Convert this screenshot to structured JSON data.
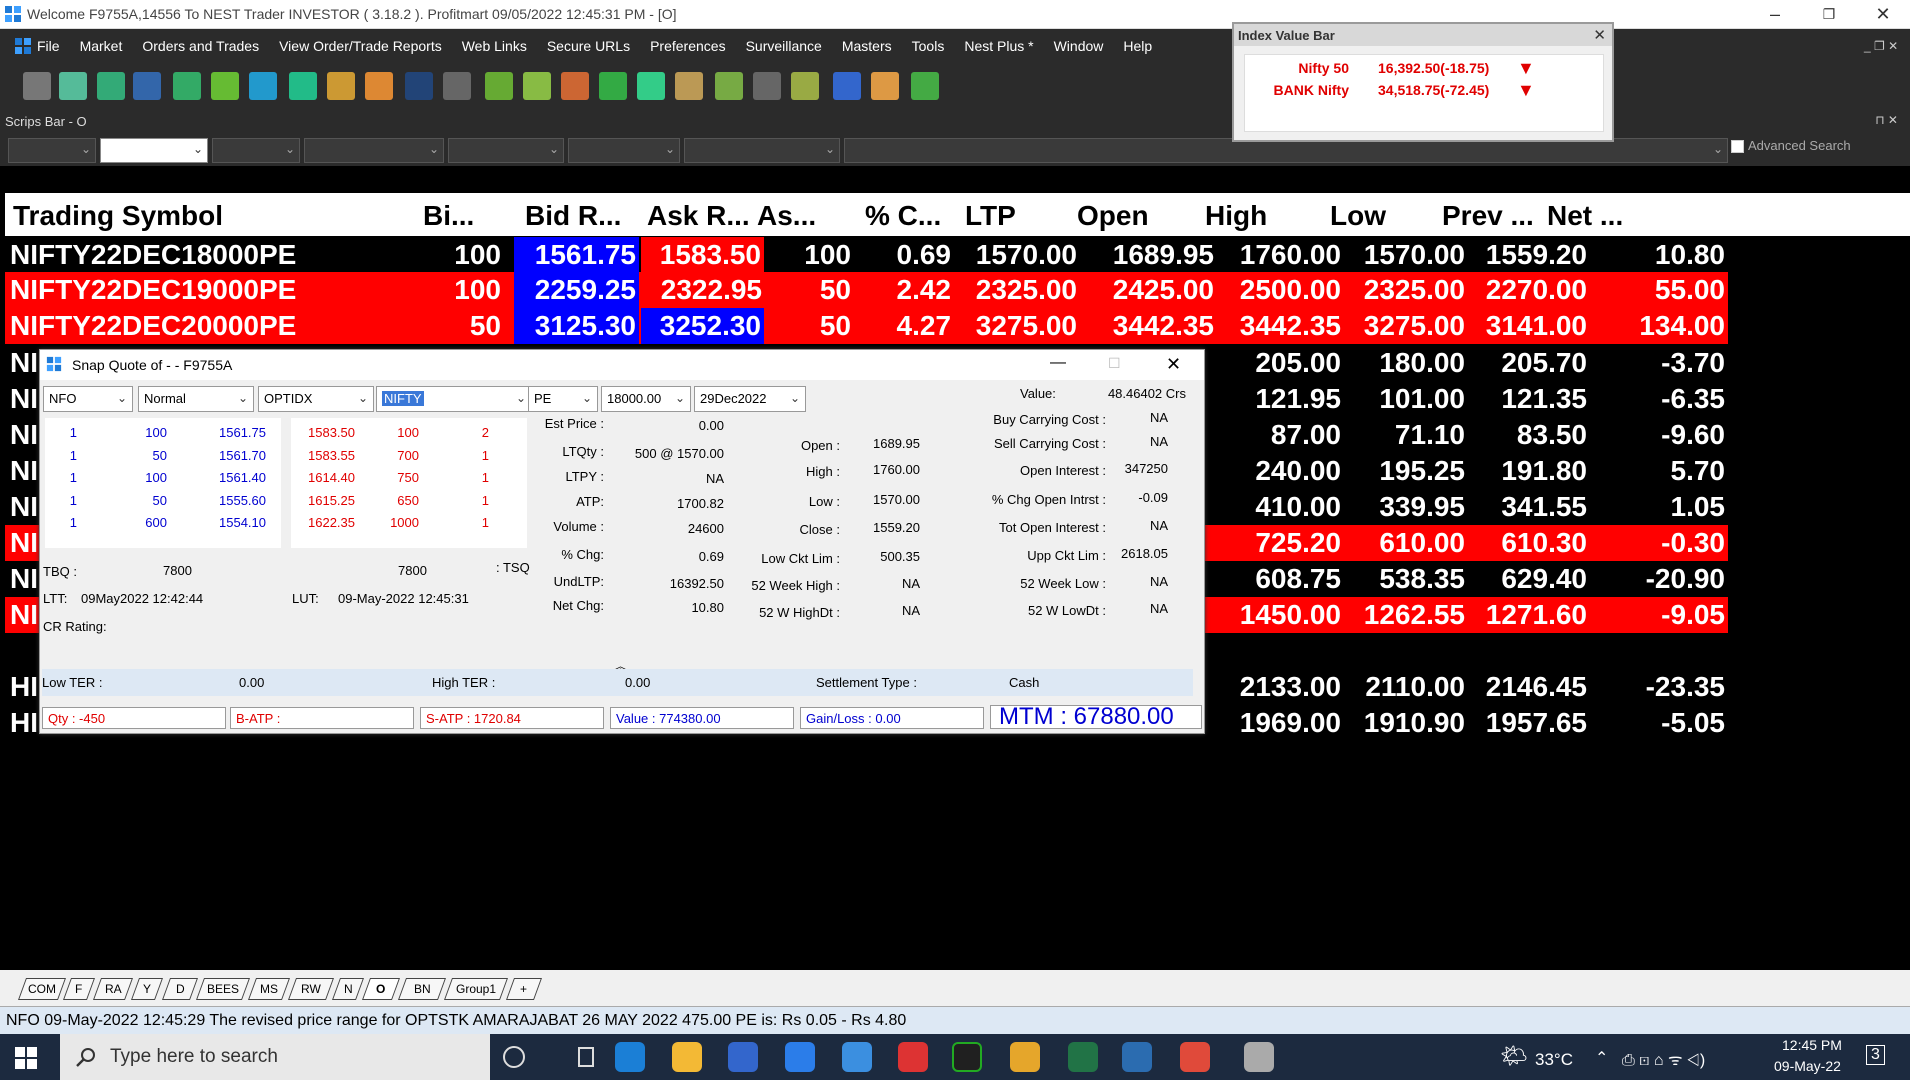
{
  "window": {
    "title": "Welcome F9755A,14556 To NEST Trader INVESTOR ( 3.18.2 ).  Profitmart  09/05/2022  12:45:31 PM - [O]"
  },
  "menu": [
    "File",
    "Market",
    "Orders and Trades",
    "View Order/Trade Reports",
    "Web Links",
    "Secure URLs",
    "Preferences",
    "Surveillance",
    "Masters",
    "Tools",
    "Nest Plus *",
    "Window",
    "Help"
  ],
  "scrips_bar": {
    "label": "Scrips Bar - O",
    "advanced_search": "Advanced Search"
  },
  "index_value_bar": {
    "title": "Index Value Bar",
    "rows": [
      {
        "name": "Nifty 50",
        "value": "16,392.50(-18.75)"
      },
      {
        "name": "BANK Nifty",
        "value": "34,518.75(-72.45)"
      }
    ]
  },
  "market_watch": {
    "headers": [
      "Trading Symbol",
      "Bi...",
      "Bid R...",
      "Ask R...",
      "As...",
      "% C...",
      "LTP",
      "Open",
      "High",
      "Low",
      "Prev ...",
      "Net ..."
    ],
    "rows": [
      {
        "sym": "NIFTY22DEC18000PE",
        "bq": "100",
        "bid": "1561.75",
        "ask": "1583.50",
        "aq": "100",
        "chg": "0.69",
        "ltp": "1570.00",
        "open": "1689.95",
        "high": "1760.00",
        "low": "1570.00",
        "prev": "1559.20",
        "net": "10.80"
      },
      {
        "sym": "NIFTY22DEC19000PE",
        "bq": "100",
        "bid": "2259.25",
        "ask": "2322.95",
        "aq": "50",
        "chg": "2.42",
        "ltp": "2325.00",
        "open": "2425.00",
        "high": "2500.00",
        "low": "2325.00",
        "prev": "2270.00",
        "net": "55.00"
      },
      {
        "sym": "NIFTY22DEC20000PE",
        "bq": "50",
        "bid": "3125.30",
        "ask": "3252.30",
        "aq": "50",
        "chg": "4.27",
        "ltp": "3275.00",
        "open": "3442.35",
        "high": "3442.35",
        "low": "3275.00",
        "prev": "3141.00",
        "net": "134.00"
      },
      {
        "sym": "NI",
        "high": "205.00",
        "low": "180.00",
        "prev": "205.70",
        "net": "-3.70"
      },
      {
        "sym": "NI",
        "high": "121.95",
        "low": "101.00",
        "prev": "121.35",
        "net": "-6.35"
      },
      {
        "sym": "NI",
        "high": "87.00",
        "low": "71.10",
        "prev": "83.50",
        "net": "-9.60"
      },
      {
        "sym": "NI",
        "high": "240.00",
        "low": "195.25",
        "prev": "191.80",
        "net": "5.70"
      },
      {
        "sym": "NI",
        "high": "410.00",
        "low": "339.95",
        "prev": "341.55",
        "net": "1.05"
      },
      {
        "sym": "NI",
        "high": "725.20",
        "low": "610.00",
        "prev": "610.30",
        "net": "-0.30"
      },
      {
        "sym": "NI",
        "high": "608.75",
        "low": "538.35",
        "prev": "629.40",
        "net": "-20.90"
      },
      {
        "sym": "NI",
        "high": "1450.00",
        "low": "1262.55",
        "prev": "1271.60",
        "net": "-9.05"
      },
      {
        "sym": "HI",
        "high": "2133.00",
        "low": "2110.00",
        "prev": "2146.45",
        "net": "-23.35"
      },
      {
        "sym": "HI",
        "high": "1969.00",
        "low": "1910.90",
        "prev": "1957.65",
        "net": "-5.05"
      }
    ]
  },
  "snap_quote": {
    "title": "Snap Quote of  -  - F9755A",
    "filters": [
      "NFO",
      "Normal",
      "OPTIDX",
      "NIFTY",
      "PE",
      "18000.00",
      "29Dec2022"
    ],
    "value_label": "Value:",
    "value": "48.46402 Crs",
    "bids": [
      {
        "o": "1",
        "q": "100",
        "p": "1561.75"
      },
      {
        "o": "1",
        "q": "50",
        "p": "1561.70"
      },
      {
        "o": "1",
        "q": "100",
        "p": "1561.40"
      },
      {
        "o": "1",
        "q": "50",
        "p": "1555.60"
      },
      {
        "o": "1",
        "q": "600",
        "p": "1554.10"
      }
    ],
    "asks": [
      {
        "p": "1583.50",
        "q": "100",
        "o": "2"
      },
      {
        "p": "1583.55",
        "q": "700",
        "o": "1"
      },
      {
        "p": "1614.40",
        "q": "750",
        "o": "1"
      },
      {
        "p": "1615.25",
        "q": "650",
        "o": "1"
      },
      {
        "p": "1622.35",
        "q": "1000",
        "o": "1"
      }
    ],
    "tbq_label": "TBQ :",
    "tbq": "7800",
    "tsq": "7800",
    "tsq_label": ": TSQ",
    "ltt_label": "LTT:",
    "ltt": "09May2022 12:42:44",
    "lut_label": "LUT:",
    "lut": "09-May-2022 12:45:31",
    "cr_rating": "CR Rating:",
    "col1": [
      {
        "l": "Est Price :",
        "v": "0.00"
      },
      {
        "l": "LTQty :",
        "v": "500 @  1570.00"
      },
      {
        "l": "LTPY :",
        "v": "NA"
      },
      {
        "l": "ATP:",
        "v": "1700.82"
      },
      {
        "l": "Volume :",
        "v": "24600"
      },
      {
        "l": "% Chg:",
        "v": "0.69"
      },
      {
        "l": "UndLTP:",
        "v": "16392.50"
      },
      {
        "l": "Net Chg:",
        "v": "10.80"
      }
    ],
    "col2": [
      {
        "l": "Open :",
        "v": "1689.95"
      },
      {
        "l": "High :",
        "v": "1760.00"
      },
      {
        "l": "Low :",
        "v": "1570.00"
      },
      {
        "l": "Close :",
        "v": "1559.20"
      },
      {
        "l": "Low Ckt Lim :",
        "v": "500.35"
      },
      {
        "l": "52 Week High :",
        "v": "NA"
      },
      {
        "l": "52 W HighDt :",
        "v": "NA"
      }
    ],
    "col3": [
      {
        "l": "Buy Carrying Cost :",
        "v": "NA"
      },
      {
        "l": "Sell Carrying Cost :",
        "v": "NA"
      },
      {
        "l": "Open Interest :",
        "v": "347250"
      },
      {
        "l": "% Chg Open Intrst :",
        "v": "-0.09"
      },
      {
        "l": "Tot Open Interest :",
        "v": "NA"
      },
      {
        "l": "Upp Ckt Lim :",
        "v": "2618.05"
      },
      {
        "l": "52 Week Low :",
        "v": "NA"
      },
      {
        "l": "52 W LowDt :",
        "v": "NA"
      }
    ],
    "low_ter_label": "Low TER :",
    "low_ter": "0.00",
    "high_ter_label": "High TER :",
    "high_ter": "0.00",
    "settlement_label": "Settlement Type :",
    "settlement": "Cash",
    "qty": "Qty : -450",
    "batp": "B-ATP :",
    "satp": "S-ATP : 1720.84",
    "value_box": "Value : 774380.00",
    "gainloss": "Gain/Loss : 0.00",
    "mtm": "MTM : 67880.00"
  },
  "tabs": [
    "COM",
    "F",
    "RA",
    "Y",
    "D",
    "BEES",
    "MS",
    "RW",
    "N",
    "O",
    "BN",
    "Group1",
    "+"
  ],
  "message": "NFO 09-May-2022 12:45:29 The revised price range for OPTSTK AMARAJABAT 26 MAY 2022 475.00 PE is: Rs 0.05 - Rs 4.80",
  "taskbar": {
    "search_placeholder": "Type here to search",
    "temperature": "33°C",
    "time": "12:45 PM",
    "date": "09-May-22",
    "notif": "3"
  },
  "colors": {
    "red": "#ff0000",
    "blue": "#0000ff",
    "black": "#000000"
  }
}
